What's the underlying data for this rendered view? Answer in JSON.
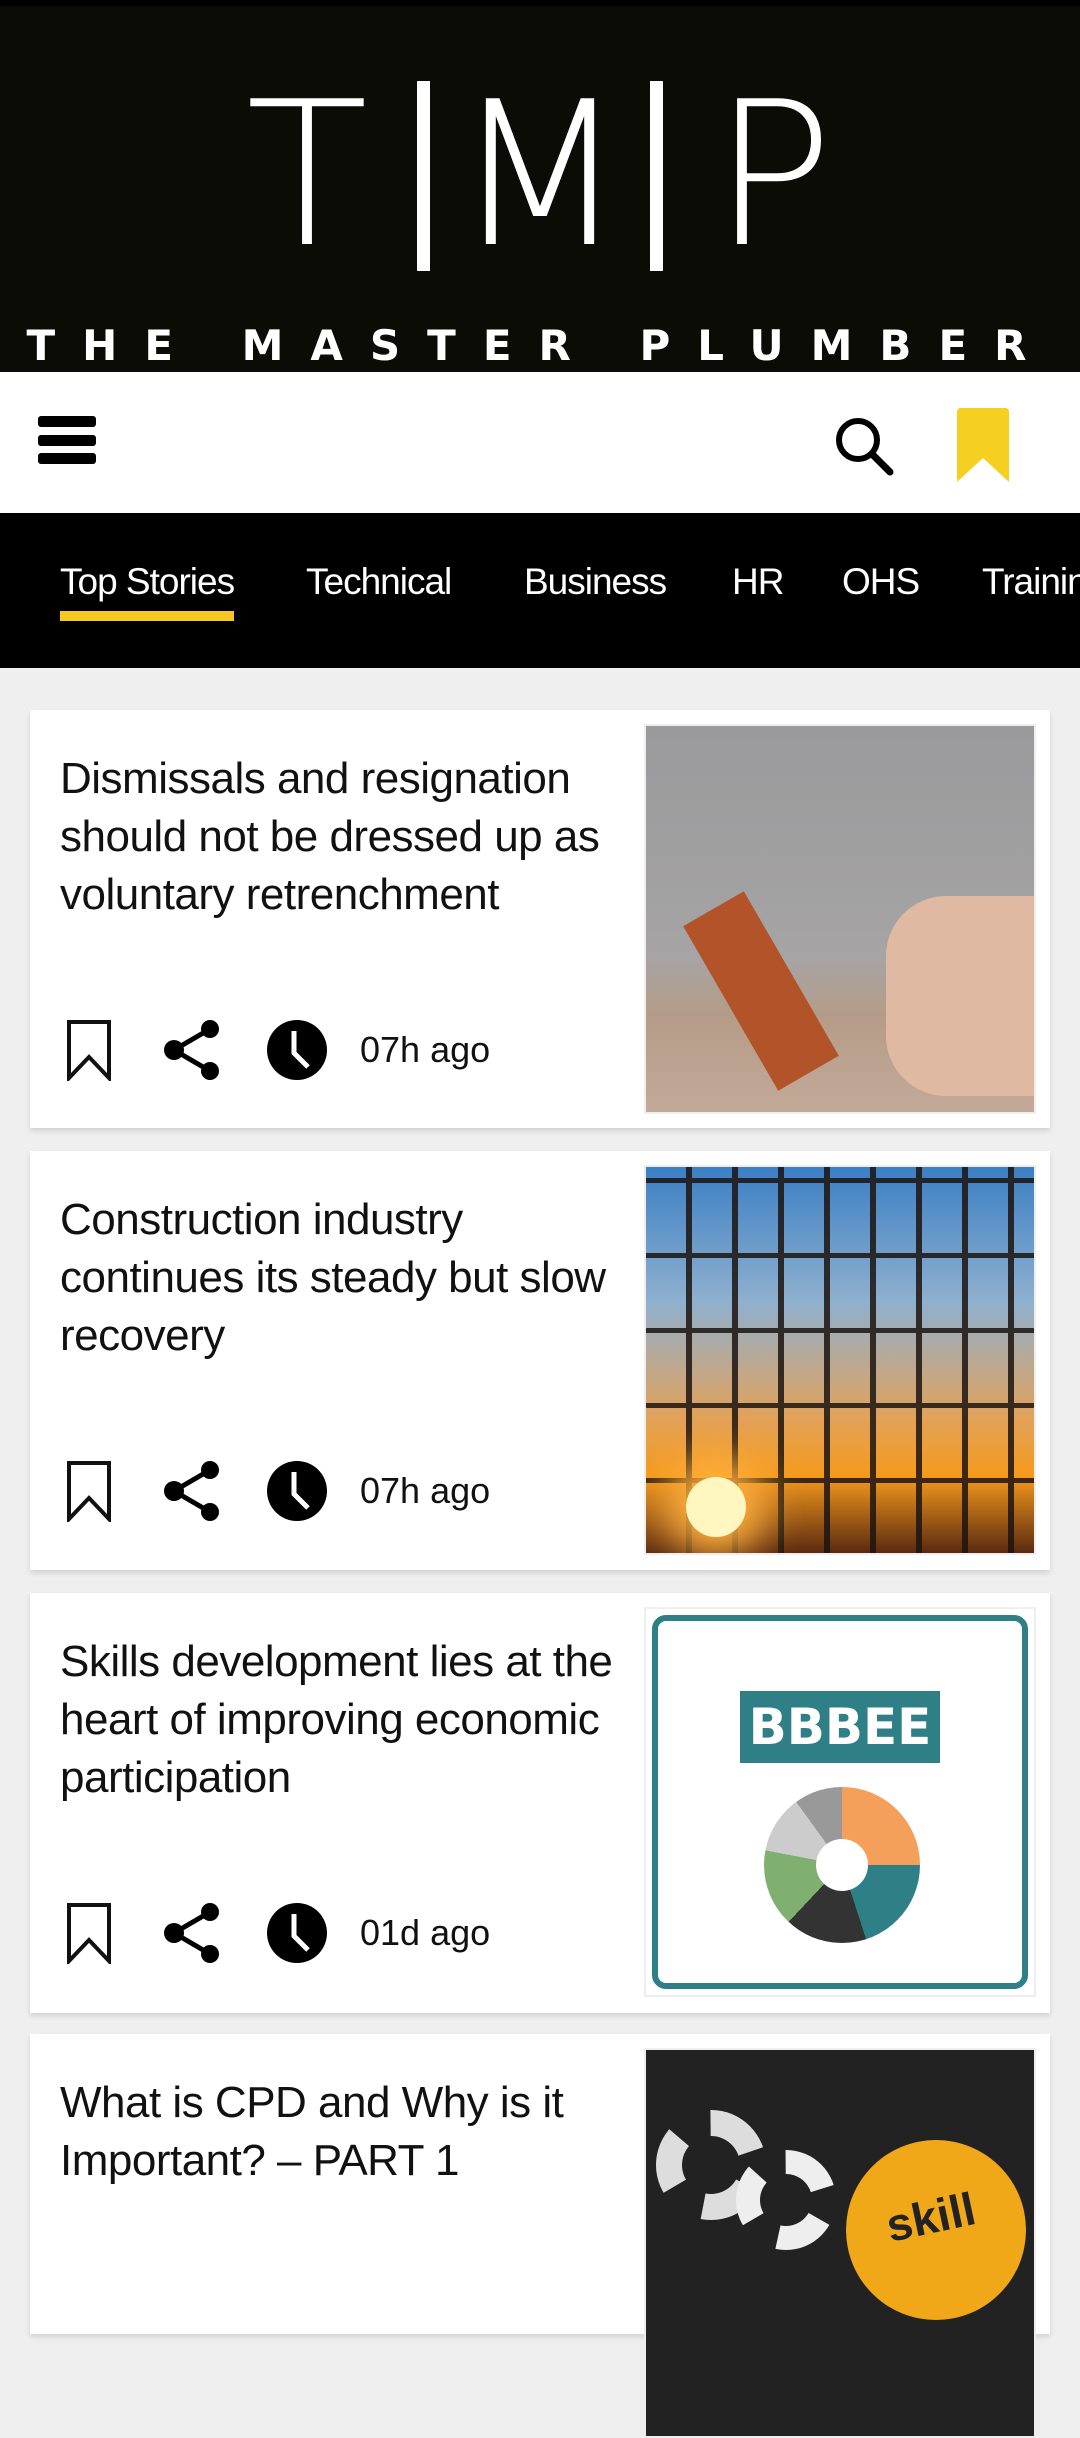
{
  "brand": {
    "letters": [
      "T",
      "M",
      "P"
    ],
    "tagline": "THE MASTER PLUMBER",
    "accent": "#f5c922"
  },
  "toolbar": {
    "menu_icon": "hamburger-icon",
    "search_icon": "search-icon",
    "bookmarks_icon": "bookmark-icon"
  },
  "nav": {
    "tabs": [
      {
        "label": "Top Stories",
        "active": true
      },
      {
        "label": "Technical"
      },
      {
        "label": "Business"
      },
      {
        "label": "HR"
      },
      {
        "label": "OHS"
      },
      {
        "label": "Training"
      }
    ]
  },
  "articles": [
    {
      "title": "Dismissals and resignation should not be dressed up as voluntary retrenchment",
      "time": "07h ago"
    },
    {
      "title": "Construction industry continues its steady but slow recovery",
      "time": "07h ago"
    },
    {
      "title": "Skills development lies at the heart of improving economic participation",
      "time": "01d ago",
      "image_text": "BBBEE"
    },
    {
      "title": "What is CPD and Why is it Important? – PART 1",
      "time": "",
      "image_text": "skill"
    }
  ]
}
